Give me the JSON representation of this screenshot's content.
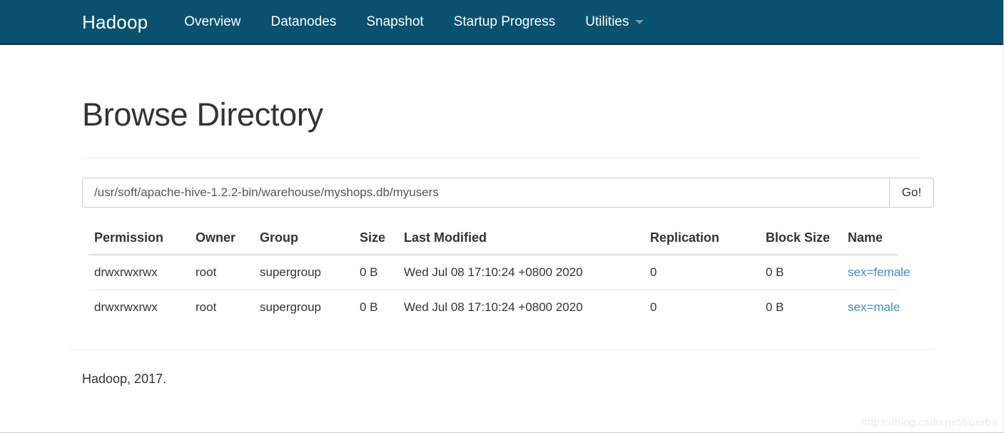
{
  "navbar": {
    "brand": "Hadoop",
    "links": [
      {
        "label": "Overview",
        "name": "nav-link-overview"
      },
      {
        "label": "Datanodes",
        "name": "nav-link-datanodes"
      },
      {
        "label": "Snapshot",
        "name": "nav-link-snapshot"
      },
      {
        "label": "Startup Progress",
        "name": "nav-link-startup-progress"
      }
    ],
    "dropdown": {
      "label": "Utilities",
      "caret_icon": "chevron-down-icon"
    },
    "background_color": "#09516f"
  },
  "main": {
    "title": "Browse Directory",
    "path": {
      "value": "/usr/soft/apache-hive-1.2.2-bin/warehouse/myshops.db/myusers",
      "placeholder": "Enter a directory path",
      "go_label": "Go!"
    },
    "table": {
      "headers": [
        "Permission",
        "Owner",
        "Group",
        "Size",
        "Last Modified",
        "Replication",
        "Block Size",
        "Name"
      ],
      "rows": [
        {
          "permission": "drwxrwxrwx",
          "owner": "root",
          "group": "supergroup",
          "size": "0 B",
          "last_modified": "Wed Jul 08 17:10:24 +0800 2020",
          "replication": "0",
          "block_size": "0 B",
          "name": "sex=female"
        },
        {
          "permission": "drwxrwxrwx",
          "owner": "root",
          "group": "supergroup",
          "size": "0 B",
          "last_modified": "Wed Jul 08 17:10:24 +0800 2020",
          "replication": "0",
          "block_size": "0 B",
          "name": "sex=male"
        }
      ],
      "link_color": "#428bca"
    }
  },
  "footer": {
    "text": "Hadoop, 2017."
  },
  "watermark": {
    "text": "https://blog.csdn.net/buerba"
  }
}
